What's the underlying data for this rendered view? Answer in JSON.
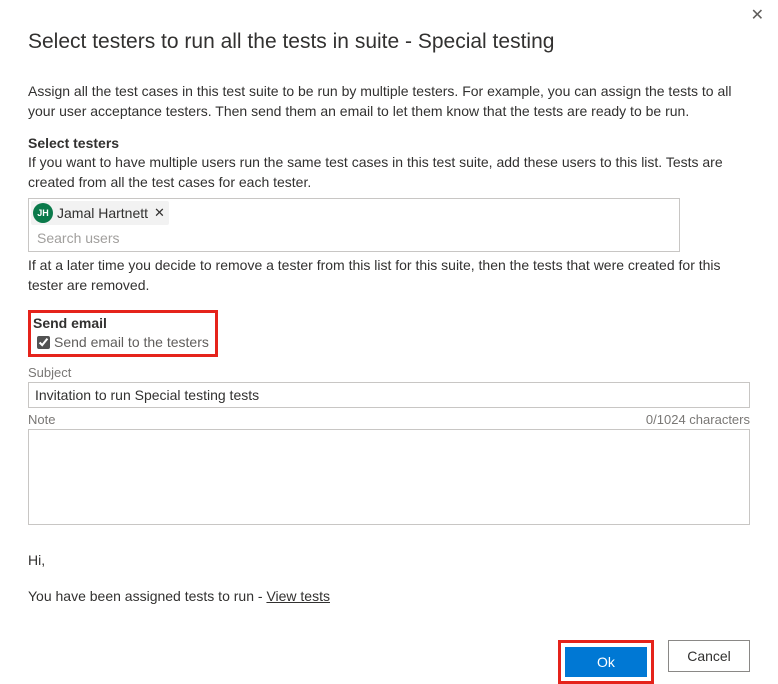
{
  "dialog": {
    "title": "Select testers to run all the tests in suite - Special testing",
    "description": "Assign all the test cases in this test suite to be run by multiple testers. For example, you can assign the tests to all your user acceptance testers. Then send them an email to let them know that the tests are ready to be run."
  },
  "selectTesters": {
    "heading": "Select testers",
    "subdesc": "If you want to have multiple users run the same test cases in this test suite, add these users to this list. Tests are created from all the test cases for each tester.",
    "chip": {
      "initials": "JH",
      "name": "Jamal Hartnett"
    },
    "searchPlaceholder": "Search users",
    "noteAfter": "If at a later time you decide to remove a tester from this list for this suite, then the tests that were created for this tester are removed."
  },
  "sendEmail": {
    "heading": "Send email",
    "checkboxLabel": "Send email to the testers",
    "checked": true,
    "subjectLabel": "Subject",
    "subjectValue": "Invitation to run Special testing tests",
    "noteLabel": "Note",
    "charCount": "0/1024 characters",
    "noteValue": ""
  },
  "preview": {
    "greeting": "Hi,",
    "body": "You have been assigned tests to run - ",
    "link": "View tests"
  },
  "buttons": {
    "ok": "Ok",
    "cancel": "Cancel"
  }
}
